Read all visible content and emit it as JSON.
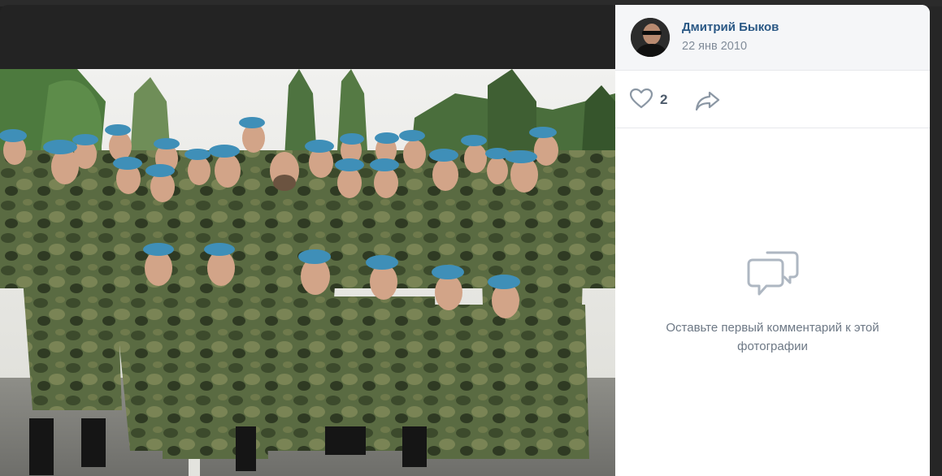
{
  "post": {
    "author_name": "Дмитрий Быков",
    "date": "22 янв 2010",
    "likes": "2"
  },
  "comments": {
    "empty_text": "Оставьте первый комментарий к этой фотографии"
  },
  "icons": {
    "like": "heart-icon",
    "share": "share-arrow-icon",
    "comments": "speech-bubble-icon"
  },
  "colors": {
    "author_link": "#2a5885",
    "secondary_text": "#818c99",
    "panel_bg": "#ffffff",
    "header_bg": "#f5f6f8",
    "beret": "#3f8fb8",
    "camouflage": "#4e6138"
  }
}
